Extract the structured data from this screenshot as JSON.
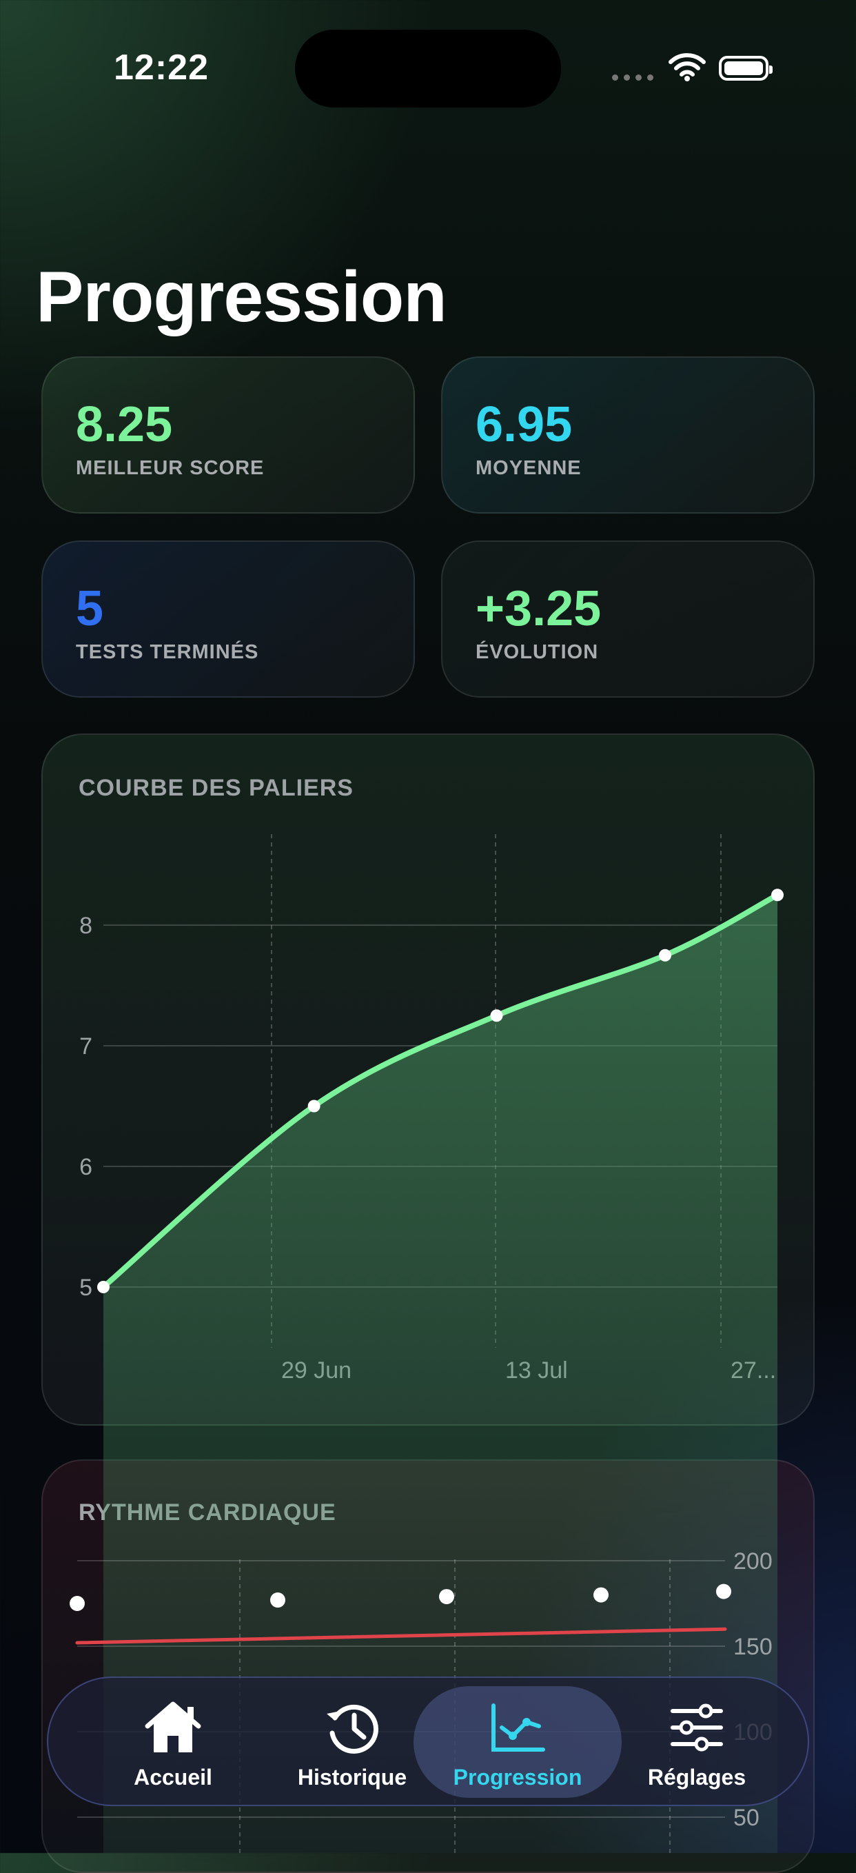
{
  "status_bar": {
    "time": "12:22"
  },
  "page_title": "Progression",
  "stats": [
    {
      "value": "8.25",
      "label": "MEILLEUR SCORE",
      "color": "#7cf29a"
    },
    {
      "value": "6.95",
      "label": "MOYENNE",
      "color": "#33d8f0"
    },
    {
      "value": "5",
      "label": "TESTS TERMINÉS",
      "color": "#2f6ff0"
    },
    {
      "value": "+3.25",
      "label": "ÉVOLUTION",
      "color": "#7cf29a"
    }
  ],
  "chart_card_title": "COURBE DES PALIERS",
  "heart_card_title": "RYTHME CARDIAQUE",
  "chart_data": [
    {
      "type": "area",
      "title": "COURBE DES PALIERS",
      "x": [
        "2024-06-15",
        "2024-06-30",
        "2024-07-13",
        "2024-07-25",
        "2024-08-02"
      ],
      "values": [
        5.0,
        6.5,
        7.25,
        7.75,
        8.25
      ],
      "y_ticks": [
        5,
        6,
        7,
        8
      ],
      "x_tick_labels": [
        "29 Jun",
        "13 Jul",
        "27..."
      ],
      "ylim": [
        4.3,
        8.75
      ],
      "grid": true,
      "line_color": "#7cf29a"
    },
    {
      "type": "scatter",
      "title": "RYTHME CARDIAQUE",
      "values": [
        175,
        177,
        179,
        180,
        182
      ],
      "trend": [
        152,
        160
      ],
      "y_ticks": [
        50,
        100,
        150,
        200
      ],
      "grid": true,
      "trend_color": "#e0444a"
    }
  ],
  "tabs": [
    {
      "label": "Accueil",
      "icon": "home-icon",
      "active": false
    },
    {
      "label": "Historique",
      "icon": "history-icon",
      "active": false
    },
    {
      "label": "Progression",
      "icon": "chart-icon",
      "active": true
    },
    {
      "label": "Réglages",
      "icon": "sliders-icon",
      "active": false
    }
  ]
}
